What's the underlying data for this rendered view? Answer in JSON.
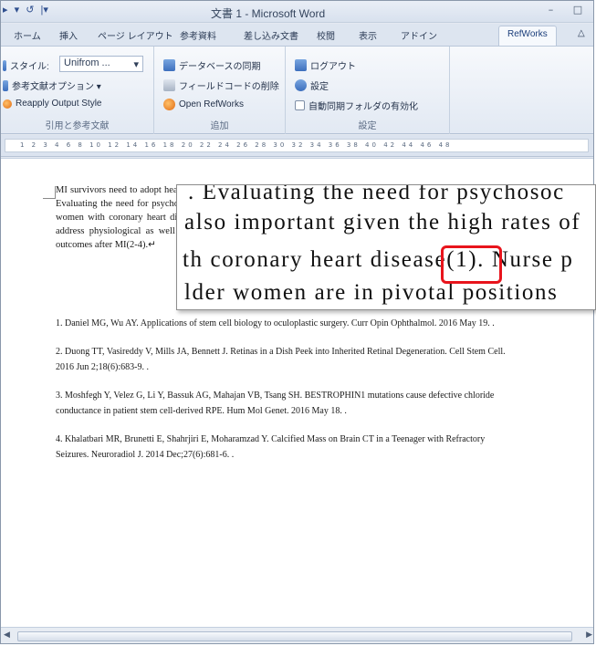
{
  "titlebar": {
    "qat_icons": [
      "▸",
      "▾",
      "↺",
      "|▾"
    ],
    "title": "文書 1 - Microsoft Word",
    "minimize": "–",
    "restore": "□"
  },
  "tabs": [
    "ホーム",
    "挿入",
    "ページ レイアウト",
    "参考資料",
    "差し込み文書",
    "校閲",
    "表示",
    "アドイン",
    "RefWorks",
    "△"
  ],
  "active_tab": "RefWorks",
  "ribbon": {
    "group1": {
      "style_label": "スタイル:",
      "style_value": "Unifrom ...",
      "style_arrow": "▾",
      "options": "参考文献オプション ▾",
      "reapply": "Reapply Output Style",
      "label": "引用と参考文献"
    },
    "group2": {
      "sync": "データベースの同期",
      "remove_fields": "フィールドコードの削除",
      "open": "Open RefWorks",
      "label": "追加"
    },
    "group3": {
      "logout": "ログアウト",
      "settings": "設定",
      "autosync": "自動同期フォルダの有効化",
      "label": "設定"
    }
  },
  "ruler": {
    "ticks": "1  2  3  4  6  8  10  12  14  16  18  20  22  24  26  28  30  32  34  36  38  40  42  44  46  48"
  },
  "document": {
    "body": "MI survivors need to adopt healthy lifestyle behaviors such as exercise, diet modification, and medication adherence. Evaluating the need for psychosocial support in women is also important given the high rates of depression among women with coronary heart disease(1). Nurse practitioners in the care of older women are in pivotal positions to address physiological as well as psychological sequelae post MI and implement interventions to improve their outcomes after MI(2-4).↵",
    "references_title": "References.",
    "references": [
      "1. Daniel MG, Wu AY. Applications of stem cell biology to oculoplastic surgery. Curr Opin Ophthalmol. 2016 May 19. .",
      "2. Duong TT, Vasireddy V, Mills JA, Bennett J. Retinas in a Dish Peek into Inherited Retinal Degeneration. Cell Stem Cell. 2016 Jun 2;18(6):683-9. .",
      "3. Moshfegh Y, Velez G, Li Y, Bassuk AG, Mahajan VB, Tsang SH. BESTROPHIN1 mutations cause defective chloride conductance in patient stem cell-derived RPE. Hum Mol Genet. 2016 May 18. .",
      "4. Khalatbari MR, Brunetti E, Shahrjiri E, Moharamzad Y. Calcified Mass on Brain CT in a Teenager with Refractory Seizures. Neuroradiol J. 2014 Dec;27(6):681-6. ."
    ]
  },
  "zoom": {
    "line1": ". Evaluating the need for psychosoc",
    "line2": "also important given the high rates of",
    "line3_a": "th coronary heart disea",
    "line3_b": "se(1). Nurse p",
    "line4": "lder women are in pivotal positions",
    "highlight_color": "#e8141c"
  },
  "colors": {
    "active_tab": "#f6f9fd",
    "ribbon": "#e2e9f3",
    "highlight": "#e8141c"
  }
}
